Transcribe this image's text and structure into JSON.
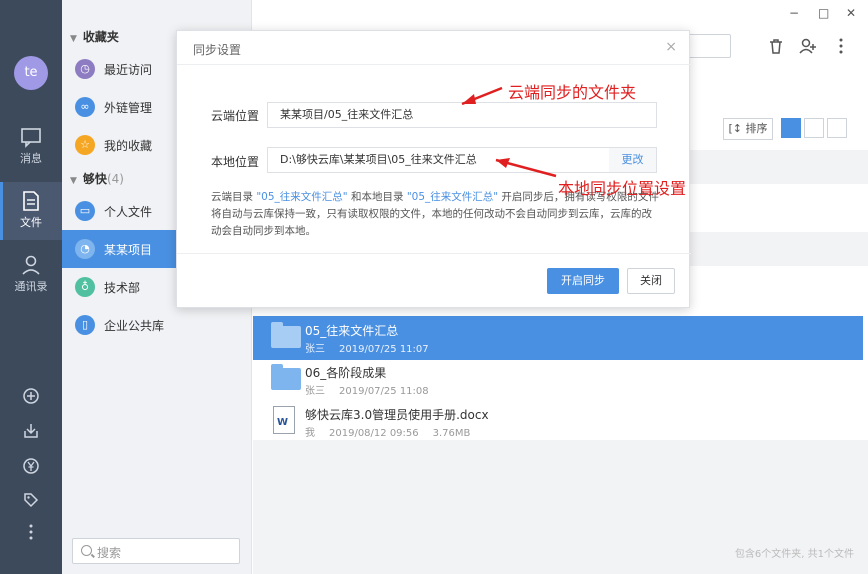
{
  "rail": {
    "avatar_initials": "te",
    "items": [
      {
        "label": "消息",
        "icon": "message-icon"
      },
      {
        "label": "文件",
        "icon": "file-icon"
      },
      {
        "label": "通讯录",
        "icon": "contacts-icon"
      }
    ],
    "bottom_icons": [
      "add-icon",
      "download-icon",
      "yen-icon",
      "tag-icon",
      "more-vertical-icon"
    ]
  },
  "sidebar": {
    "favorites_title": "收藏夹",
    "favorites": [
      {
        "label": "最近访问",
        "color": "#8e7cc3",
        "icon": "recent-icon"
      },
      {
        "label": "外链管理",
        "color": "#4a90e2",
        "icon": "link-icon"
      },
      {
        "label": "我的收藏",
        "color": "#f5a623",
        "icon": "star-icon"
      }
    ],
    "library_title": "够快",
    "library_count": "(4)",
    "libraries": [
      {
        "label": "个人文件",
        "color": "#4a90e2",
        "icon": "personal-icon"
      },
      {
        "label": "某某项目",
        "color": "#7fb5ee",
        "icon": "project-icon",
        "active": true
      },
      {
        "label": "技术部",
        "color": "#50c0a0",
        "icon": "team-icon"
      },
      {
        "label": "企业公共库",
        "color": "#4a90e2",
        "icon": "enterprise-icon"
      }
    ],
    "search_placeholder": "搜索"
  },
  "window": {
    "minimize": "−",
    "maximize": "□",
    "close": "✕"
  },
  "toolbar": {
    "sort_label": "排序"
  },
  "files": [
    {
      "name": "05_往来文件汇总",
      "owner": "张三",
      "date": "2019/07/25 11:07",
      "size": "",
      "type": "folder",
      "active": true
    },
    {
      "name": "06_各阶段成果",
      "owner": "张三",
      "date": "2019/07/25 11:08",
      "size": "",
      "type": "folder",
      "active": false
    },
    {
      "name": "够快云库3.0管理员使用手册.docx",
      "owner": "我",
      "date": "2019/08/12 09:56",
      "size": "3.76MB",
      "type": "docx",
      "active": false
    }
  ],
  "docx_badge": "W",
  "footer_stat": "包含6个文件夹, 共1个文件",
  "dialog": {
    "title": "同步设置",
    "close": "×",
    "cloud_label": "云端位置",
    "cloud_value": "某某项目/05_往来文件汇总",
    "local_label": "本地位置",
    "local_value": "D:\\够快云库\\某某项目\\05_往来文件汇总",
    "change_label": "更改",
    "desc_1": "云端目录 ",
    "desc_hl1": "\"05_往来文件汇总\"",
    "desc_2": " 和本地目录 ",
    "desc_hl2": "\"05_往来文件汇总\"",
    "desc_3": " 开启同步后，拥有读写权限的文件将自动与云库保持一致，只有读取权限的文件，本地的任何改动不会自动同步到云库，云库的改动会自动同步到本地。",
    "start_sync": "开启同步",
    "close_btn": "关闭"
  },
  "annotations": {
    "cloud_note": "云端同步的文件夹",
    "local_note": "本地同步位置设置",
    "color": "#e02020"
  }
}
